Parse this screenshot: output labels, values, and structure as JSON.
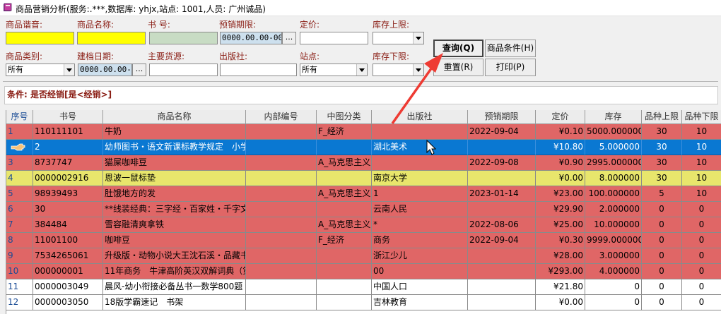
{
  "window": {
    "title": "商品营销分析(服务:.***,数据库: yhjx,站点: 1001,人员: 广州诚品)"
  },
  "form": {
    "pinyin_label": "商品谐音:",
    "name_label": "商品名称:",
    "isbn_label": "书    号:",
    "presale_label": "预销期限:",
    "presale_value": "0000.00.00-000",
    "price_label": "定价:",
    "stock_max_label": "库存上限:",
    "category_label": "商品类别:",
    "category_value": "所有",
    "created_label": "建档日期:",
    "created_value": "0000.00.00-0",
    "supplier_label": "主要货源:",
    "publisher_label": "出版社:",
    "site_label": "站点:",
    "site_value": "所有",
    "stock_min_label": "库存下限:",
    "ellipsis": "..."
  },
  "buttons": {
    "query": "查询(Q)",
    "conditions": "商品条件(H)",
    "reset": "重置(R)",
    "print": "打印(P)"
  },
  "condition": {
    "text": "条件: 是否经销[是<经销>]"
  },
  "table": {
    "headers": [
      "序号",
      "书号",
      "商品名称",
      "内部编号",
      "中图分类",
      "出版社",
      "预销期限",
      "定价",
      "库存",
      "品种上限",
      "品种下限"
    ],
    "rows": [
      {
        "idx": "1",
        "isbn": "110111101",
        "name": "牛奶",
        "internal": "",
        "cls": "F_经济",
        "publisher": "",
        "presale": "2022-09-04",
        "price": "¥0.10",
        "stock": "5000.000000",
        "max": "30",
        "min": "10",
        "style": "red"
      },
      {
        "idx": "",
        "isbn": "2",
        "name": "幼师图书・语文新课标教学规定　小学",
        "internal": "",
        "cls": "",
        "publisher": "湖北美术",
        "presale": "",
        "price": "¥10.80",
        "stock": "5.000000",
        "max": "30",
        "min": "10",
        "style": "sel"
      },
      {
        "idx": "3",
        "isbn": "8737747",
        "name": "猫屎咖啡豆",
        "internal": "",
        "cls": "A_马克思主义",
        "publisher": "",
        "presale": "2022-09-08",
        "price": "¥0.90",
        "stock": "2995.000000",
        "max": "30",
        "min": "10",
        "style": "red"
      },
      {
        "idx": "4",
        "isbn": "0000002916",
        "name": "恩波一鼠标垫",
        "internal": "",
        "cls": "",
        "publisher": "南京大学",
        "presale": "",
        "price": "¥0.00",
        "stock": "8.000000",
        "max": "30",
        "min": "10",
        "style": "yellow"
      },
      {
        "idx": "5",
        "isbn": "98939493",
        "name": "肚饿地方的发",
        "internal": "",
        "cls": "A_马克思主义",
        "publisher": "1",
        "presale": "2023-01-14",
        "price": "¥23.00",
        "stock": "100.000000",
        "max": "5",
        "min": "10",
        "style": "red"
      },
      {
        "idx": "6",
        "isbn": "30",
        "name": "**线装经典：三字经・百家姓・千字文",
        "internal": "",
        "cls": "",
        "publisher": "云南人民",
        "presale": "",
        "price": "¥29.90",
        "stock": "2.000000",
        "max": "0",
        "min": "0",
        "style": "red"
      },
      {
        "idx": "7",
        "isbn": "384484",
        "name": "雪容融清爽拿铁",
        "internal": "",
        "cls": "A_马克思主义",
        "publisher": "*",
        "presale": "2022-08-06",
        "price": "¥25.00",
        "stock": "10.000000",
        "max": "0",
        "min": "0",
        "style": "red"
      },
      {
        "idx": "8",
        "isbn": "11001100",
        "name": "咖啡豆",
        "internal": "",
        "cls": "F_经济",
        "publisher": "商务",
        "presale": "2022-09-04",
        "price": "¥0.30",
        "stock": "9999.000000",
        "max": "0",
        "min": "0",
        "style": "red"
      },
      {
        "idx": "9",
        "isbn": "7534265061",
        "name": "升级版・动物小说大王沈石溪・品藏书",
        "internal": "",
        "cls": "",
        "publisher": "浙江少儿",
        "presale": "",
        "price": "¥28.00",
        "stock": "3.000000",
        "max": "0",
        "min": "0",
        "style": "red"
      },
      {
        "idx": "10",
        "isbn": "000000001",
        "name": "11年商务　牛津高阶英汉双解词典（第",
        "internal": "",
        "cls": "",
        "publisher": "00",
        "presale": "",
        "price": "¥293.00",
        "stock": "4.000000",
        "max": "0",
        "min": "0",
        "style": "red"
      },
      {
        "idx": "11",
        "isbn": "0000003049",
        "name": "晨风-幼小衔接必备丛书一数学800题",
        "internal": "",
        "cls": "",
        "publisher": "中国人口",
        "presale": "",
        "price": "¥21.80",
        "stock": "0",
        "max": "0",
        "min": "0",
        "style": "white"
      },
      {
        "idx": "12",
        "isbn": "0000003050",
        "name": "18版学霸速记　书架",
        "internal": "",
        "cls": "",
        "publisher": "吉林教育",
        "presale": "",
        "price": "¥0.00",
        "stock": "0",
        "max": "0",
        "min": "0",
        "style": "white"
      }
    ]
  },
  "colors": {
    "row_red": "#e06666",
    "row_yellow": "#e8e66c",
    "row_selected": "#0a78d2",
    "annotation_arrow": "#ee3b33",
    "label": "#8a1d14"
  },
  "icons": {
    "app": "book-icon",
    "cursor": "mouse-pointer-icon",
    "row_indicator": "pointing-hand-icon"
  }
}
